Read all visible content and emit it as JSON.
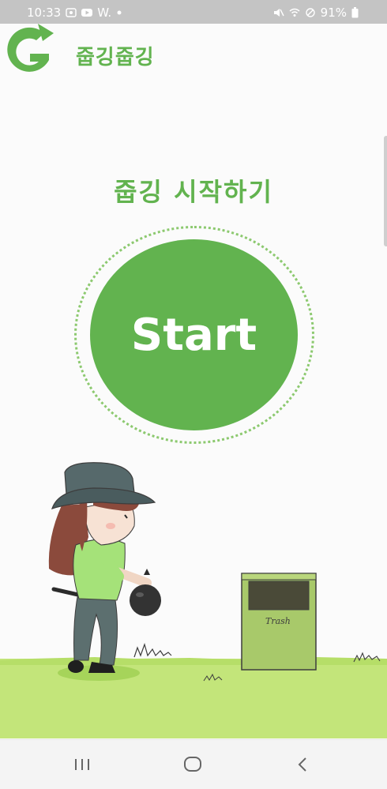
{
  "status_bar": {
    "time": "10:33",
    "notification_text": "W.",
    "battery": "91%",
    "icons": [
      "screen-record-icon",
      "youtube-icon",
      "dot-icon",
      "mute-icon",
      "wifi-icon",
      "do-not-disturb-icon",
      "battery-icon"
    ]
  },
  "app_bar": {
    "logo_icon": "g-logo-icon",
    "title": "줍깅줍깅"
  },
  "main": {
    "headline": "줍깅 시작하기",
    "start_button_label": "Start"
  },
  "illustration": {
    "trash_can_label": "Trash",
    "icons": [
      "girl-illustration",
      "trash-bag-icon",
      "trash-can-icon",
      "grass-icon"
    ]
  },
  "nav_bar": {
    "icons": [
      "recent-apps-icon",
      "home-icon",
      "back-icon"
    ]
  },
  "colors": {
    "brand_green": "#62b34f",
    "ring_green": "#8cc96f",
    "ground_green": "#c3e57a",
    "status_bar_gray": "#c4c4c4"
  }
}
